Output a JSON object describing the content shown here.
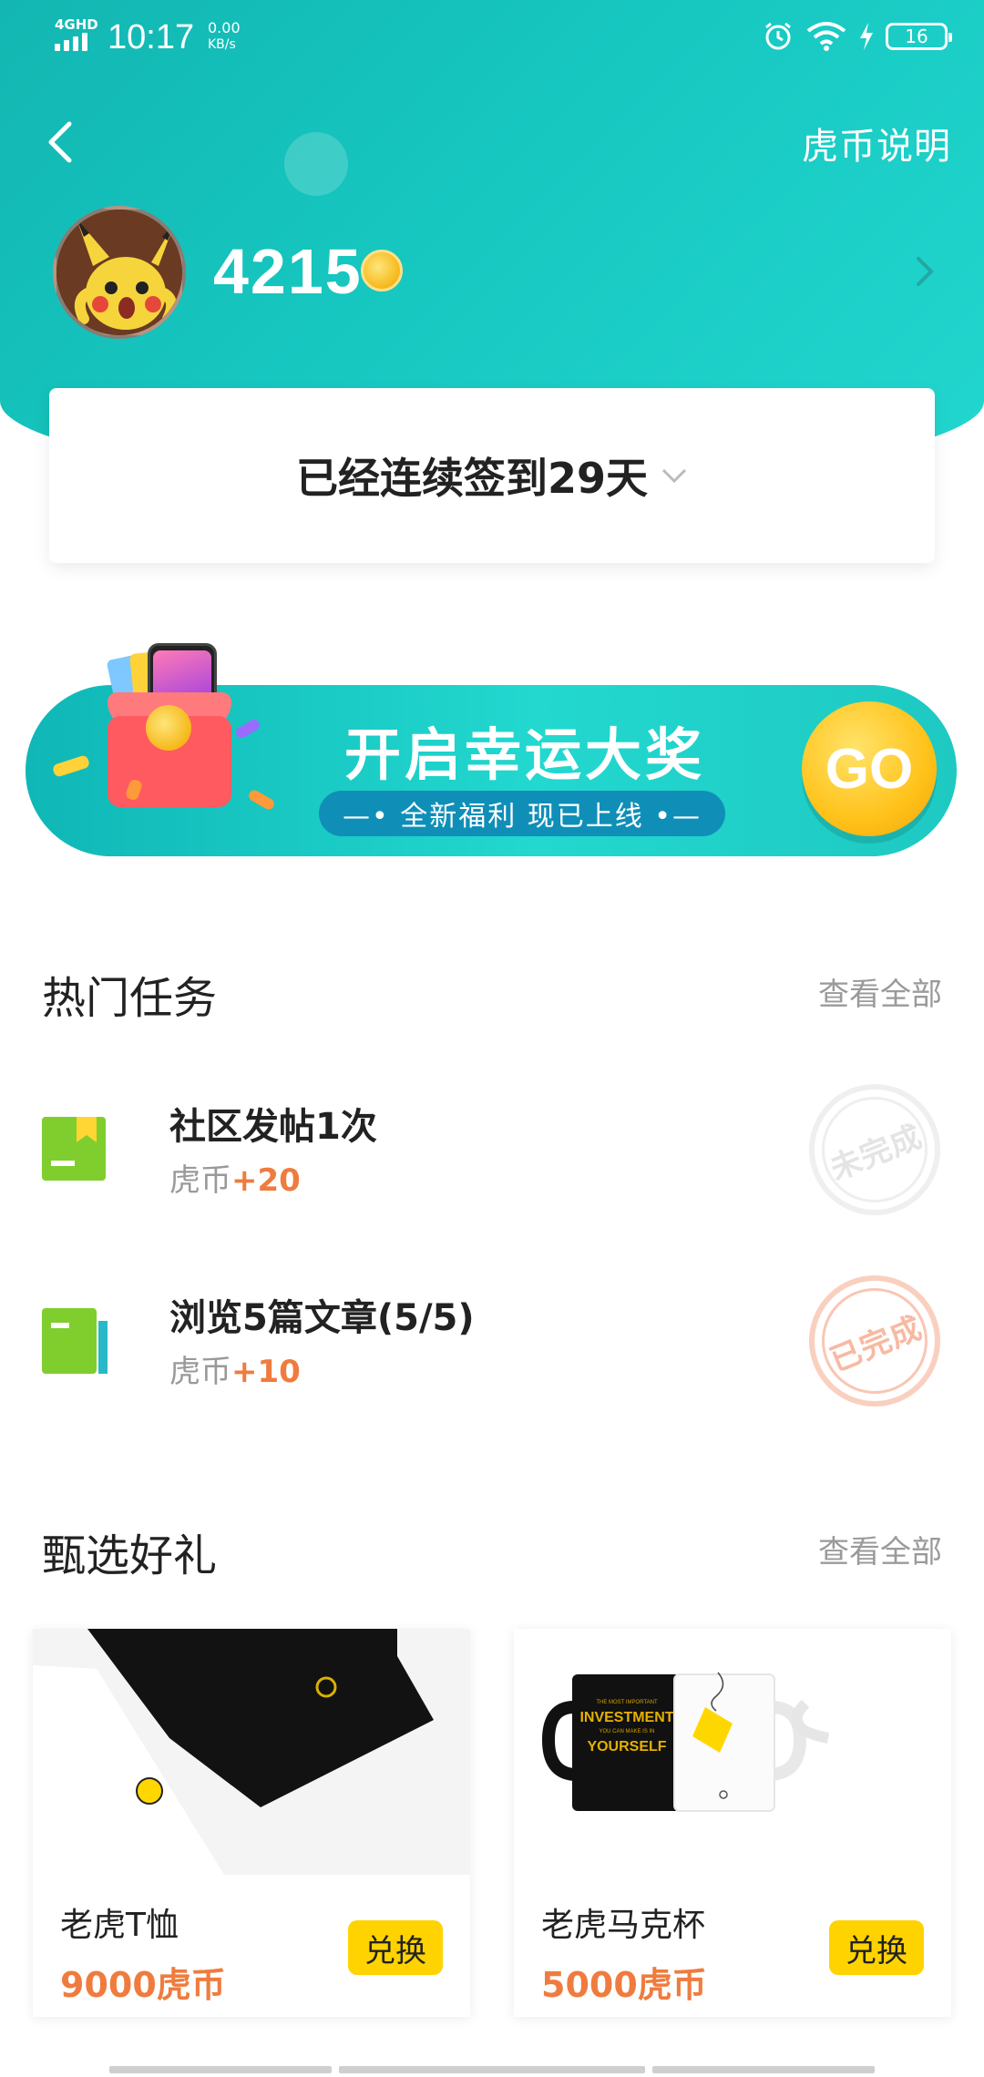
{
  "status_bar": {
    "network": "4GHD",
    "time": "10:17",
    "speed_value": "0.00",
    "speed_unit": "KB/s",
    "battery": "16",
    "icons": [
      "alarm-icon",
      "wifi-icon",
      "charging-icon",
      "battery-icon"
    ]
  },
  "header": {
    "back_icon": "back-arrow-icon",
    "rules_link": "虎币说明"
  },
  "profile": {
    "coin_balance": "4215",
    "coin_icon": "coin-icon",
    "more_icon": "chevron-right-icon"
  },
  "signin": {
    "text": "已经连续签到29天",
    "expand_icon": "chevron-down-icon"
  },
  "promo_banner": {
    "title": "开启幸运大奖",
    "subtitle": "—• 全新福利  现已上线 •—",
    "go_label": "GO"
  },
  "hot_tasks": {
    "title": "热门任务",
    "see_all": "查看全部",
    "items": [
      {
        "name": "社区发帖1次",
        "reward_label": "虎币",
        "reward_value": "+20",
        "status": "未完成"
      },
      {
        "name": "浏览5篇文章(5/5)",
        "reward_label": "虎币",
        "reward_value": "+10",
        "status": "已完成"
      }
    ]
  },
  "gifts": {
    "title": "甄选好礼",
    "see_all": "查看全部",
    "items": [
      {
        "name": "老虎T恤",
        "price": "9000虎币",
        "button": "兑换"
      },
      {
        "name": "老虎马克杯",
        "price": "5000虎币",
        "button": "兑换"
      }
    ],
    "mug_print": [
      "THE MOST IMPORTANT",
      "INVESTMENT",
      "YOU CAN MAKE IS IN",
      "YOURSELF"
    ]
  },
  "colors": {
    "header_gradient_start": "#13b6b2",
    "header_gradient_end": "#22d7cf",
    "accent_orange": "#ef7c3e",
    "exchange_yellow": "#ffd300",
    "go_yellow": "#ffc21a"
  }
}
